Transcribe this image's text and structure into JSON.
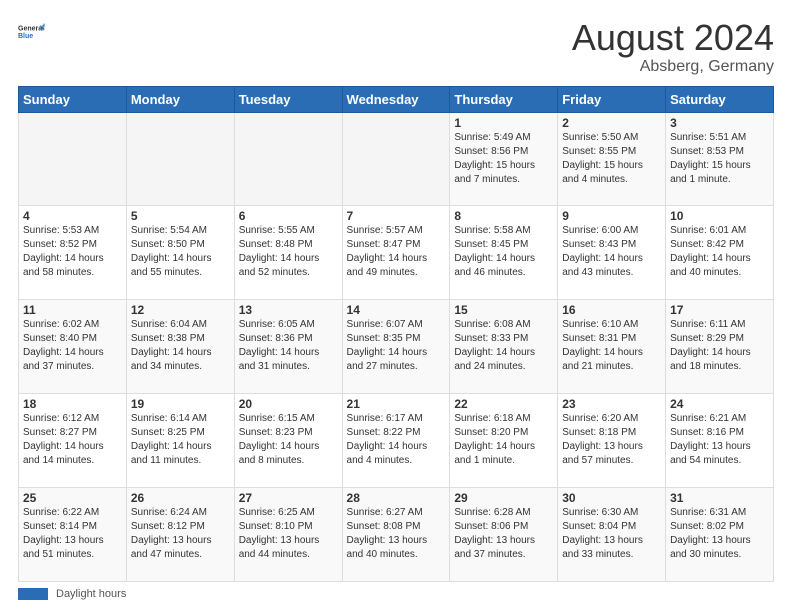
{
  "header": {
    "logo_line1": "General",
    "logo_line2": "Blue",
    "month": "August 2024",
    "location": "Absberg, Germany"
  },
  "days_of_week": [
    "Sunday",
    "Monday",
    "Tuesday",
    "Wednesday",
    "Thursday",
    "Friday",
    "Saturday"
  ],
  "weeks": [
    [
      {
        "day": "",
        "info": ""
      },
      {
        "day": "",
        "info": ""
      },
      {
        "day": "",
        "info": ""
      },
      {
        "day": "",
        "info": ""
      },
      {
        "day": "1",
        "info": "Sunrise: 5:49 AM\nSunset: 8:56 PM\nDaylight: 15 hours and 7 minutes."
      },
      {
        "day": "2",
        "info": "Sunrise: 5:50 AM\nSunset: 8:55 PM\nDaylight: 15 hours and 4 minutes."
      },
      {
        "day": "3",
        "info": "Sunrise: 5:51 AM\nSunset: 8:53 PM\nDaylight: 15 hours and 1 minute."
      }
    ],
    [
      {
        "day": "4",
        "info": "Sunrise: 5:53 AM\nSunset: 8:52 PM\nDaylight: 14 hours and 58 minutes."
      },
      {
        "day": "5",
        "info": "Sunrise: 5:54 AM\nSunset: 8:50 PM\nDaylight: 14 hours and 55 minutes."
      },
      {
        "day": "6",
        "info": "Sunrise: 5:55 AM\nSunset: 8:48 PM\nDaylight: 14 hours and 52 minutes."
      },
      {
        "day": "7",
        "info": "Sunrise: 5:57 AM\nSunset: 8:47 PM\nDaylight: 14 hours and 49 minutes."
      },
      {
        "day": "8",
        "info": "Sunrise: 5:58 AM\nSunset: 8:45 PM\nDaylight: 14 hours and 46 minutes."
      },
      {
        "day": "9",
        "info": "Sunrise: 6:00 AM\nSunset: 8:43 PM\nDaylight: 14 hours and 43 minutes."
      },
      {
        "day": "10",
        "info": "Sunrise: 6:01 AM\nSunset: 8:42 PM\nDaylight: 14 hours and 40 minutes."
      }
    ],
    [
      {
        "day": "11",
        "info": "Sunrise: 6:02 AM\nSunset: 8:40 PM\nDaylight: 14 hours and 37 minutes."
      },
      {
        "day": "12",
        "info": "Sunrise: 6:04 AM\nSunset: 8:38 PM\nDaylight: 14 hours and 34 minutes."
      },
      {
        "day": "13",
        "info": "Sunrise: 6:05 AM\nSunset: 8:36 PM\nDaylight: 14 hours and 31 minutes."
      },
      {
        "day": "14",
        "info": "Sunrise: 6:07 AM\nSunset: 8:35 PM\nDaylight: 14 hours and 27 minutes."
      },
      {
        "day": "15",
        "info": "Sunrise: 6:08 AM\nSunset: 8:33 PM\nDaylight: 14 hours and 24 minutes."
      },
      {
        "day": "16",
        "info": "Sunrise: 6:10 AM\nSunset: 8:31 PM\nDaylight: 14 hours and 21 minutes."
      },
      {
        "day": "17",
        "info": "Sunrise: 6:11 AM\nSunset: 8:29 PM\nDaylight: 14 hours and 18 minutes."
      }
    ],
    [
      {
        "day": "18",
        "info": "Sunrise: 6:12 AM\nSunset: 8:27 PM\nDaylight: 14 hours and 14 minutes."
      },
      {
        "day": "19",
        "info": "Sunrise: 6:14 AM\nSunset: 8:25 PM\nDaylight: 14 hours and 11 minutes."
      },
      {
        "day": "20",
        "info": "Sunrise: 6:15 AM\nSunset: 8:23 PM\nDaylight: 14 hours and 8 minutes."
      },
      {
        "day": "21",
        "info": "Sunrise: 6:17 AM\nSunset: 8:22 PM\nDaylight: 14 hours and 4 minutes."
      },
      {
        "day": "22",
        "info": "Sunrise: 6:18 AM\nSunset: 8:20 PM\nDaylight: 14 hours and 1 minute."
      },
      {
        "day": "23",
        "info": "Sunrise: 6:20 AM\nSunset: 8:18 PM\nDaylight: 13 hours and 57 minutes."
      },
      {
        "day": "24",
        "info": "Sunrise: 6:21 AM\nSunset: 8:16 PM\nDaylight: 13 hours and 54 minutes."
      }
    ],
    [
      {
        "day": "25",
        "info": "Sunrise: 6:22 AM\nSunset: 8:14 PM\nDaylight: 13 hours and 51 minutes."
      },
      {
        "day": "26",
        "info": "Sunrise: 6:24 AM\nSunset: 8:12 PM\nDaylight: 13 hours and 47 minutes."
      },
      {
        "day": "27",
        "info": "Sunrise: 6:25 AM\nSunset: 8:10 PM\nDaylight: 13 hours and 44 minutes."
      },
      {
        "day": "28",
        "info": "Sunrise: 6:27 AM\nSunset: 8:08 PM\nDaylight: 13 hours and 40 minutes."
      },
      {
        "day": "29",
        "info": "Sunrise: 6:28 AM\nSunset: 8:06 PM\nDaylight: 13 hours and 37 minutes."
      },
      {
        "day": "30",
        "info": "Sunrise: 6:30 AM\nSunset: 8:04 PM\nDaylight: 13 hours and 33 minutes."
      },
      {
        "day": "31",
        "info": "Sunrise: 6:31 AM\nSunset: 8:02 PM\nDaylight: 13 hours and 30 minutes."
      }
    ]
  ],
  "footer": {
    "daylight_label": "Daylight hours"
  }
}
